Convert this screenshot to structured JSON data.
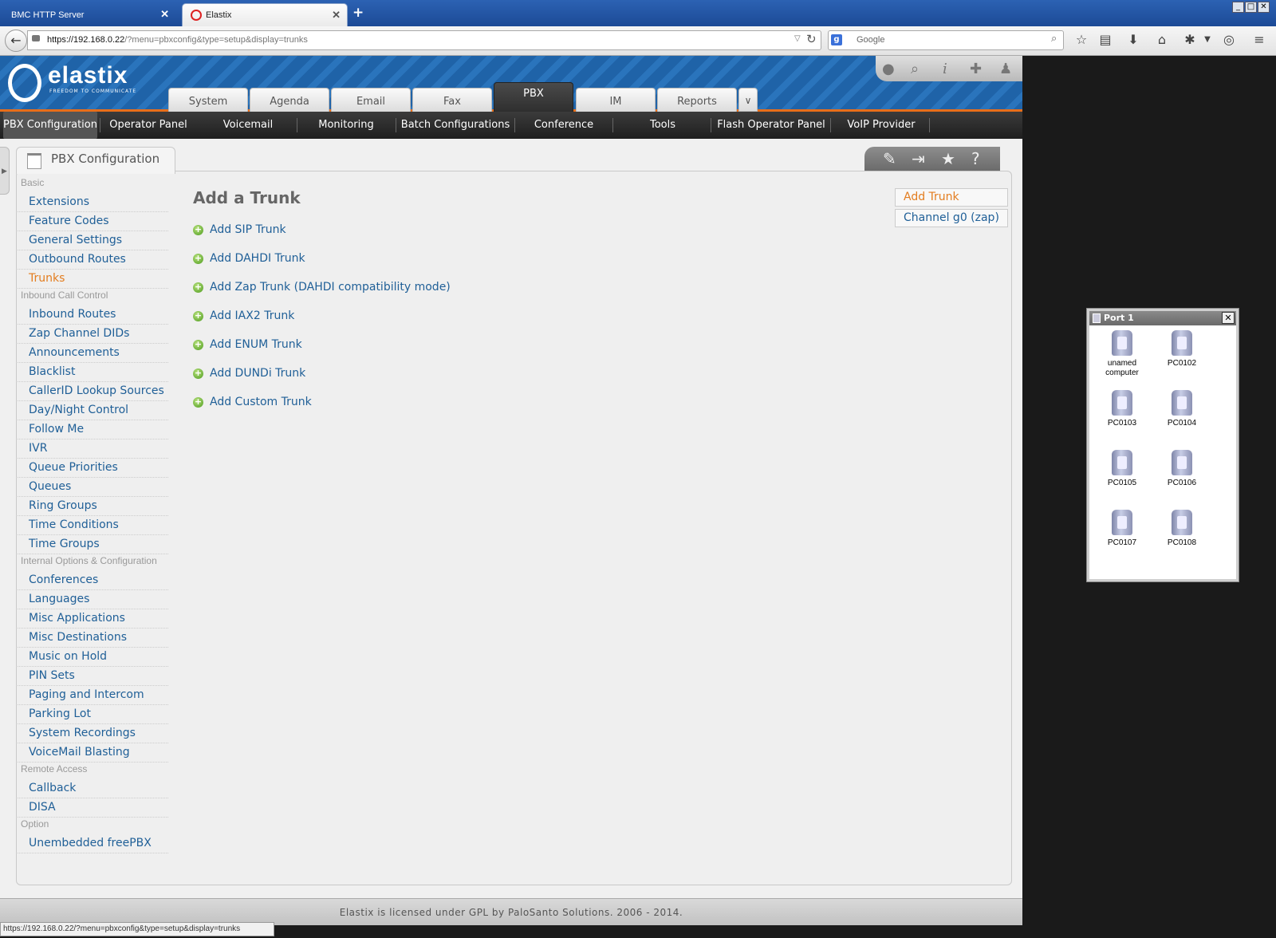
{
  "browser": {
    "tabs": [
      {
        "label": "BMC HTTP Server"
      },
      {
        "label": "Elastix"
      }
    ],
    "new_tab": "+",
    "url_host": "https://192.168.0.22",
    "url_path": "/?menu=pbxconfig&type=setup&display=trunks",
    "search_placeholder": "Google",
    "status_url": "https://192.168.0.22/?menu=pbxconfig&type=setup&display=trunks"
  },
  "header": {
    "logo": "elastix",
    "tagline": "FREEDOM TO COMMUNICATE",
    "main_tabs": [
      "System",
      "Agenda",
      "Email",
      "Fax",
      "PBX",
      "IM",
      "Reports"
    ],
    "active_tab": "PBX",
    "sub_nav": [
      "PBX Configuration",
      "Operator Panel",
      "Voicemail",
      "Monitoring",
      "Batch Configurations",
      "Conference",
      "Tools",
      "Flash Operator Panel",
      "VoIP Provider"
    ]
  },
  "panel": {
    "title": "PBX Configuration"
  },
  "sidebar": {
    "sections": [
      {
        "category": "Basic",
        "items": [
          "Extensions",
          "Feature Codes",
          "General Settings",
          "Outbound Routes",
          "Trunks"
        ]
      },
      {
        "category": "Inbound Call Control",
        "items": [
          "Inbound Routes",
          "Zap Channel DIDs",
          "Announcements",
          "Blacklist",
          "CallerID Lookup Sources",
          "Day/Night Control",
          "Follow Me",
          "IVR",
          "Queue Priorities",
          "Queues",
          "Ring Groups",
          "Time Conditions",
          "Time Groups"
        ]
      },
      {
        "category": "Internal Options & Configuration",
        "items": [
          "Conferences",
          "Languages",
          "Misc Applications",
          "Misc Destinations",
          "Music on Hold",
          "PIN Sets",
          "Paging and Intercom",
          "Parking Lot",
          "System Recordings",
          "VoiceMail Blasting"
        ]
      },
      {
        "category": "Remote Access",
        "items": [
          "Callback",
          "DISA"
        ]
      },
      {
        "category": "Option",
        "items": [
          "Unembedded freePBX"
        ]
      }
    ],
    "active_item": "Trunks"
  },
  "content": {
    "title": "Add a Trunk",
    "links": [
      "Add SIP Trunk",
      "Add DAHDI Trunk",
      "Add Zap Trunk (DAHDI compatibility mode)",
      "Add IAX2 Trunk",
      "Add ENUM Trunk",
      "Add DUNDi Trunk",
      "Add Custom Trunk"
    ]
  },
  "right_list": [
    "Add Trunk",
    "Channel g0 (zap)"
  ],
  "footer": "Elastix is licensed under GPL by PaloSanto Solutions. 2006 - 2014.",
  "port_window": {
    "title": "Port 1",
    "computers": [
      "unamed computer",
      "PC0102",
      "PC0103",
      "PC0104",
      "PC0105",
      "PC0106",
      "PC0107",
      "PC0108"
    ]
  },
  "colors": {
    "link": "#1f5f97",
    "active": "#e37d1f",
    "accent_bar": "#e86e1a",
    "header_blue": "#1f63a8"
  }
}
